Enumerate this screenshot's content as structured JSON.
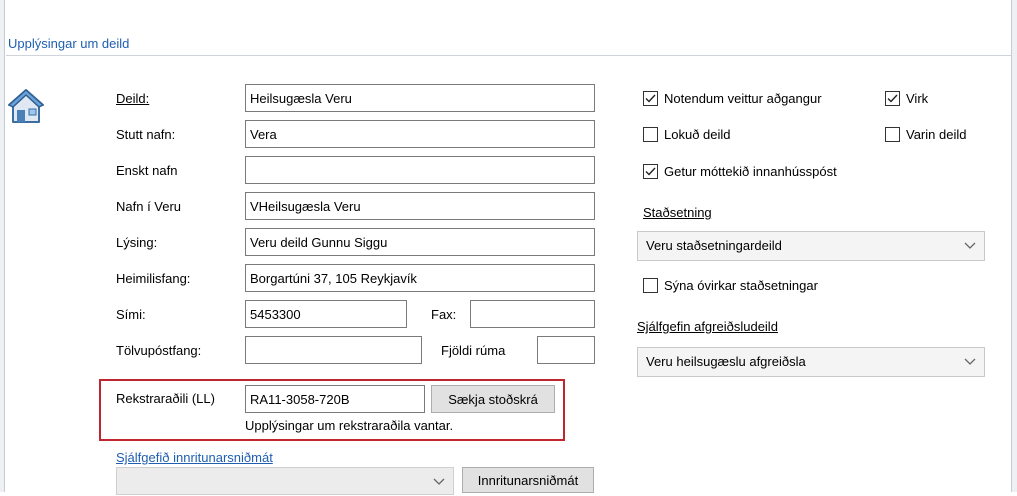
{
  "section": {
    "title": "Upplýsingar um deild"
  },
  "icons": {
    "house": "house-icon",
    "checkmark": "checkmark-icon",
    "chevron": "chevron-down-icon"
  },
  "form": {
    "deild": {
      "label": "Deild:",
      "value": "Heilsugæsla Veru"
    },
    "stutt_nafn": {
      "label": "Stutt nafn:",
      "value": "Vera"
    },
    "enskt_nafn": {
      "label": "Enskt nafn",
      "value": ""
    },
    "nafn_i_veru": {
      "label": "Nafn í Veru",
      "value": "VHeilsugæsla Veru"
    },
    "lysing": {
      "label": "Lýsing:",
      "value": "Veru deild Gunnu Siggu"
    },
    "heimilisfang": {
      "label": "Heimilisfang:",
      "value": "Borgartúni 37, 105 Reykjavík"
    },
    "simi": {
      "label": "Sími:",
      "value": "5453300"
    },
    "fax": {
      "label": "Fax:",
      "value": ""
    },
    "tolvupostfang": {
      "label": "Tölvupóstfang:",
      "value": ""
    },
    "fjoldi_ruma": {
      "label": "Fjöldi rúma",
      "value": ""
    },
    "rekstraradili": {
      "label": "Rekstraraðili (LL)",
      "value": "RA11-3058-720B",
      "button": "Sækja stoðskrá",
      "message": "Upplýsingar um rekstraraðila vantar."
    },
    "innritunarsnidmat": {
      "label": "Sjálfgefið innritunarsniðmát",
      "value": "",
      "button": "Innritunarsniðmát"
    }
  },
  "options": {
    "notendum_veittur": {
      "label": "Notendum veittur aðgangur",
      "checked": true
    },
    "virk": {
      "label": "Virk",
      "checked": true
    },
    "lokud_deild": {
      "label": "Lokuð deild",
      "checked": false
    },
    "varin_deild": {
      "label": "Varin deild",
      "checked": false
    },
    "getur_mottekid": {
      "label": "Getur móttekið innanhússpóst",
      "checked": true
    },
    "stadsetning": {
      "label": "Staðsetning",
      "value": "Veru staðsetningardeild"
    },
    "syna_ovirkar": {
      "label": "Sýna óvirkar staðsetningar",
      "checked": false
    },
    "sjalfgefin_afgr": {
      "label": "Sjálfgefin afgreiðsludeild",
      "value": "Veru heilsugæslu afgreiðsla"
    }
  },
  "colors": {
    "accent_blue": "#1f5fb0",
    "highlight_red": "#c0262f"
  }
}
